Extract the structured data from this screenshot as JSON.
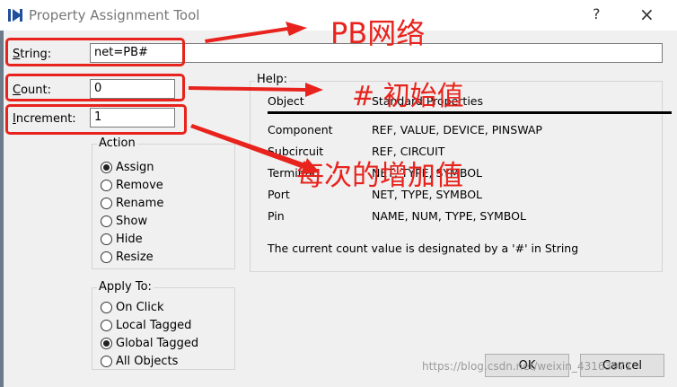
{
  "window": {
    "title": "Property Assignment Tool",
    "help_button": "?",
    "close_button": "×"
  },
  "fields": {
    "string": {
      "label": "String:",
      "accelerator": "S",
      "rest": "tring:",
      "value": "net=PB#"
    },
    "count": {
      "label": "Count:",
      "accelerator": "C",
      "rest": "ount:",
      "value": "0"
    },
    "increment": {
      "label": "Increment:",
      "accelerator": "I",
      "rest": "ncrement:",
      "value": "1"
    }
  },
  "action": {
    "title": "Action",
    "options": [
      {
        "label": "Assign",
        "selected": true
      },
      {
        "label": "Remove",
        "selected": false
      },
      {
        "label": "Rename",
        "selected": false
      },
      {
        "label": "Show",
        "selected": false
      },
      {
        "label": "Hide",
        "selected": false
      },
      {
        "label": "Resize",
        "selected": false
      }
    ]
  },
  "apply_to": {
    "title": "Apply To:",
    "options": [
      {
        "label": "On Click",
        "selected": false
      },
      {
        "label": "Local Tagged",
        "selected": false
      },
      {
        "label": "Global Tagged",
        "selected": true
      },
      {
        "label": "All Objects",
        "selected": false
      }
    ]
  },
  "help": {
    "title": "Help:",
    "header": {
      "object": "Object",
      "properties": "Standard Properties"
    },
    "rows": [
      {
        "object": "Component",
        "properties": "REF, VALUE, DEVICE, PINSWAP"
      },
      {
        "object": "Subcircuit",
        "properties": "REF, CIRCUIT"
      },
      {
        "object": "Terminal",
        "properties": "NET, TYPE, SYMBOL"
      },
      {
        "object": "Port",
        "properties": "NET, TYPE, SYMBOL"
      },
      {
        "object": "Pin",
        "properties": "NAME, NUM, TYPE, SYMBOL"
      }
    ],
    "note": "The current count value is designated by a '#' in String"
  },
  "buttons": {
    "ok": "OK",
    "cancel": "Cancel"
  },
  "annotations": {
    "string_note": "PB网络",
    "count_note": "# 初始值",
    "increment_note": "每次的增加值",
    "color": "#e8231d"
  },
  "watermark": "https://blog.csdn.net/weixin_43163971"
}
